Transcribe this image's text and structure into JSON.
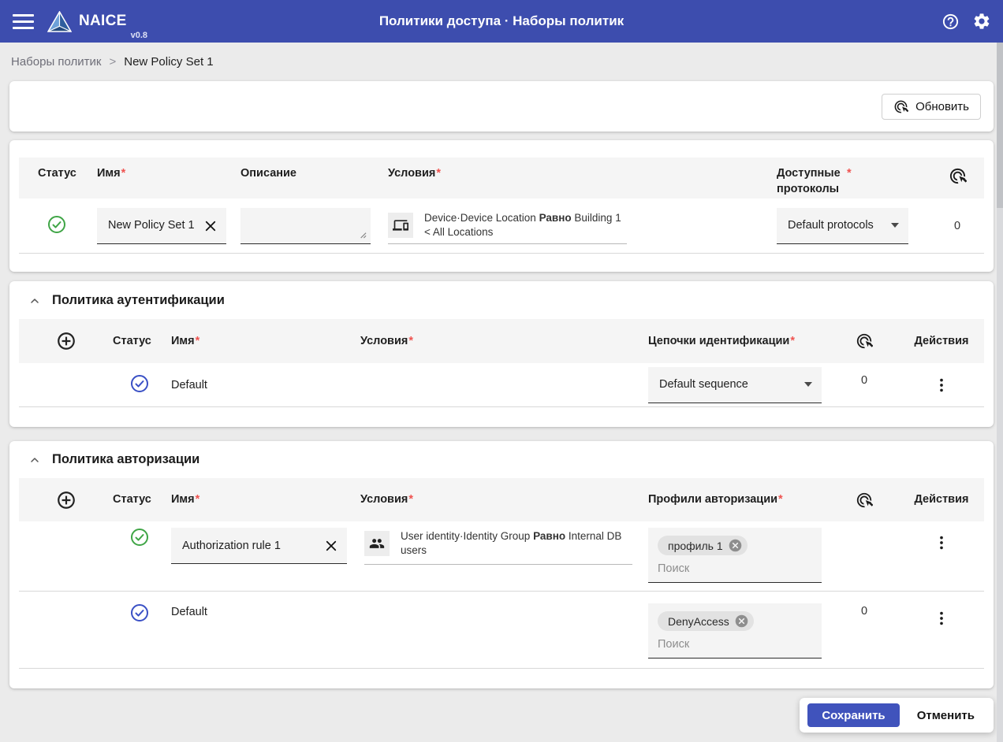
{
  "ui": {
    "required_marker": "*"
  },
  "header": {
    "brand": "NAICE",
    "version": "v0.8",
    "title": "Политики доступа · Наборы политик"
  },
  "breadcrumb": {
    "parent": "Наборы политик",
    "separator": ">",
    "current": "New Policy Set 1"
  },
  "toolbar": {
    "refresh_label": "Обновить"
  },
  "policy_set": {
    "columns": {
      "status": "Статус",
      "name": "Имя",
      "description": "Описание",
      "conditions": "Условия",
      "protocols": "Доступные протоколы"
    },
    "row": {
      "name_value": "New Policy Set 1",
      "description_value": "",
      "condition": {
        "attribute": "Device·Device Location",
        "operator": "Равно",
        "value": "Building 1 < All Locations"
      },
      "protocols_value": "Default protocols",
      "hits": "0"
    }
  },
  "authentication": {
    "title": "Политика аутентификации",
    "columns": {
      "status": "Статус",
      "name": "Имя",
      "conditions": "Условия",
      "sequence": "Цепочки идентификации",
      "actions": "Действия"
    },
    "row": {
      "name": "Default",
      "sequence_value": "Default sequence",
      "hits": "0"
    }
  },
  "authorization": {
    "title": "Политика авторизации",
    "columns": {
      "status": "Статус",
      "name": "Имя",
      "conditions": "Условия",
      "profiles": "Профили авторизации",
      "actions": "Действия"
    },
    "rows": [
      {
        "name_value": "Authorization rule 1",
        "condition": {
          "attribute": "User identity·Identity Group",
          "operator": "Равно",
          "value": "Internal DB users"
        },
        "profile_chip": "профиль 1",
        "search_placeholder": "Поиск"
      },
      {
        "name": "Default",
        "profile_chip": "DenyAccess",
        "search_placeholder": "Поиск",
        "hits": "0"
      }
    ]
  },
  "footer": {
    "save_label": "Сохранить",
    "cancel_label": "Отменить"
  },
  "colors": {
    "header_bg": "#3d4dae",
    "primary_button": "#4053bc",
    "status_ok_green": "#3fa546",
    "status_ok_blue": "#3a50c5",
    "required_marker": "#ef5350"
  }
}
